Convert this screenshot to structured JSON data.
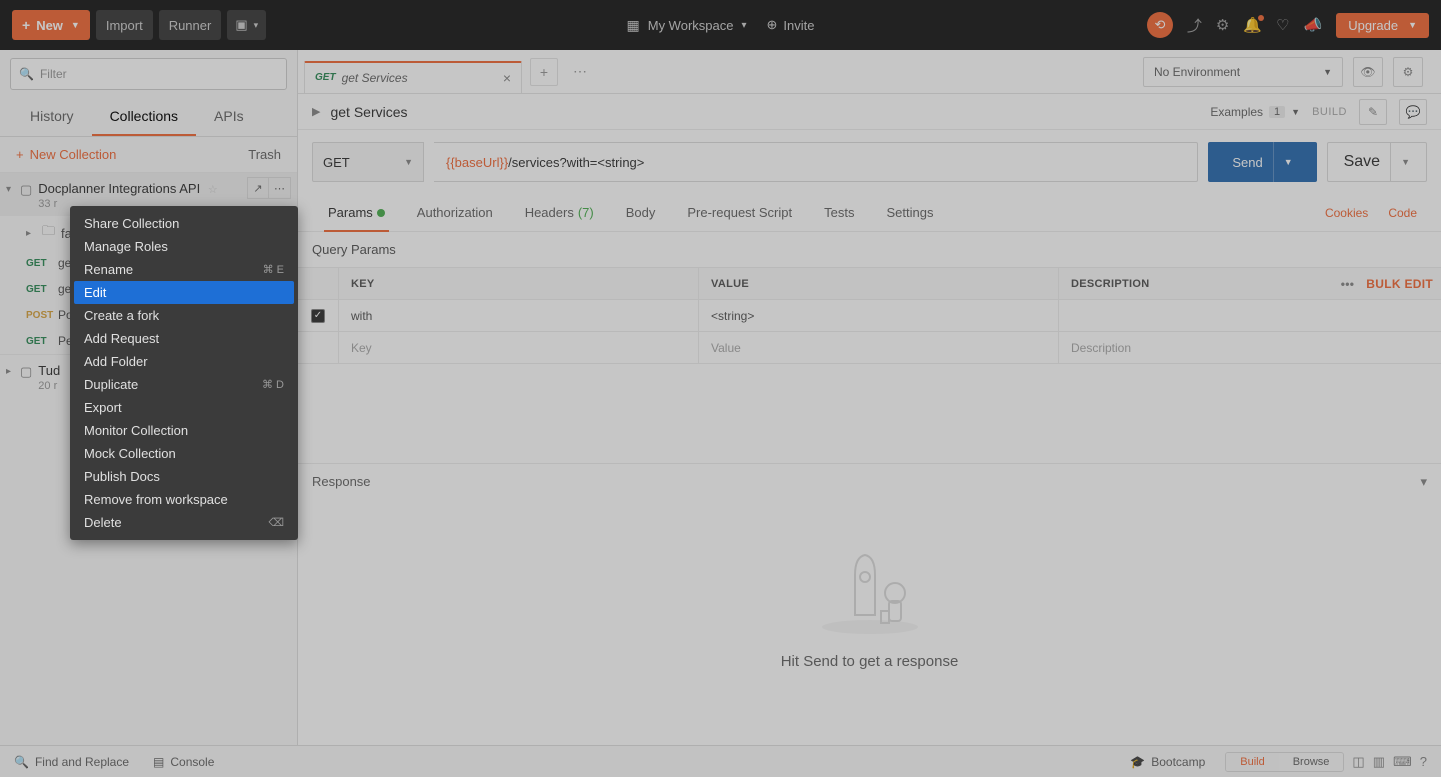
{
  "topbar": {
    "new_label": "New",
    "import_label": "Import",
    "runner_label": "Runner",
    "workspace_label": "My Workspace",
    "invite_label": "Invite",
    "upgrade_label": "Upgrade"
  },
  "sidebar": {
    "filter_placeholder": "Filter",
    "tabs": {
      "history": "History",
      "collections": "Collections",
      "apis": "APIs"
    },
    "new_collection": "New Collection",
    "trash": "Trash",
    "collections": [
      {
        "name": "Docplanner Integrations API",
        "meta": "33 r",
        "expanded": true,
        "children": [
          {
            "type": "folder",
            "name": "fa"
          },
          {
            "type": "req",
            "method": "GET",
            "name": "ge"
          },
          {
            "type": "req",
            "method": "GET",
            "name": "ge"
          },
          {
            "type": "req",
            "method": "POST",
            "name": "Po"
          },
          {
            "type": "req",
            "method": "GET",
            "name": "Pe"
          }
        ]
      },
      {
        "name": "Tud",
        "meta": "20 r",
        "expanded": false
      }
    ]
  },
  "content": {
    "tab": {
      "method": "GET",
      "name": "get Services"
    },
    "env_selector": "No Environment",
    "breadcrumb": "get Services",
    "examples_label": "Examples",
    "examples_count": "1",
    "build_label": "BUILD",
    "method": "GET",
    "url_var": "{{baseUrl}}",
    "url_rest": "/services?with=<string>",
    "send_label": "Send",
    "save_label": "Save",
    "req_tabs": {
      "params": "Params",
      "auth": "Authorization",
      "headers": "Headers",
      "headers_count": "(7)",
      "body": "Body",
      "pre": "Pre-request Script",
      "tests": "Tests",
      "settings": "Settings",
      "cookies": "Cookies",
      "code": "Code"
    },
    "qp_title": "Query Params",
    "qp_headers": {
      "key": "Key",
      "value": "Value",
      "desc": "Description"
    },
    "qp_rows": [
      {
        "checked": true,
        "key": "with",
        "value": "<string>",
        "desc": ""
      }
    ],
    "qp_placeholder": {
      "key": "Key",
      "value": "Value",
      "desc": "Description"
    },
    "bulk_edit": "Bulk Edit",
    "response_label": "Response",
    "empty_msg": "Hit Send to get a response"
  },
  "bottombar": {
    "find": "Find and Replace",
    "console": "Console",
    "bootcamp": "Bootcamp",
    "build": "Build",
    "browse": "Browse"
  },
  "context_menu": {
    "items": [
      {
        "label": "Share Collection",
        "shortcut": ""
      },
      {
        "label": "Manage Roles",
        "shortcut": ""
      },
      {
        "label": "Rename",
        "shortcut": "⌘ E"
      },
      {
        "label": "Edit",
        "shortcut": "",
        "hover": true
      },
      {
        "label": "Create a fork",
        "shortcut": ""
      },
      {
        "label": "Add Request",
        "shortcut": ""
      },
      {
        "label": "Add Folder",
        "shortcut": ""
      },
      {
        "label": "Duplicate",
        "shortcut": "⌘ D"
      },
      {
        "label": "Export",
        "shortcut": ""
      },
      {
        "label": "Monitor Collection",
        "shortcut": ""
      },
      {
        "label": "Mock Collection",
        "shortcut": ""
      },
      {
        "label": "Publish Docs",
        "shortcut": ""
      },
      {
        "label": "Remove from workspace",
        "shortcut": ""
      },
      {
        "label": "Delete",
        "shortcut": "⌫"
      }
    ]
  }
}
